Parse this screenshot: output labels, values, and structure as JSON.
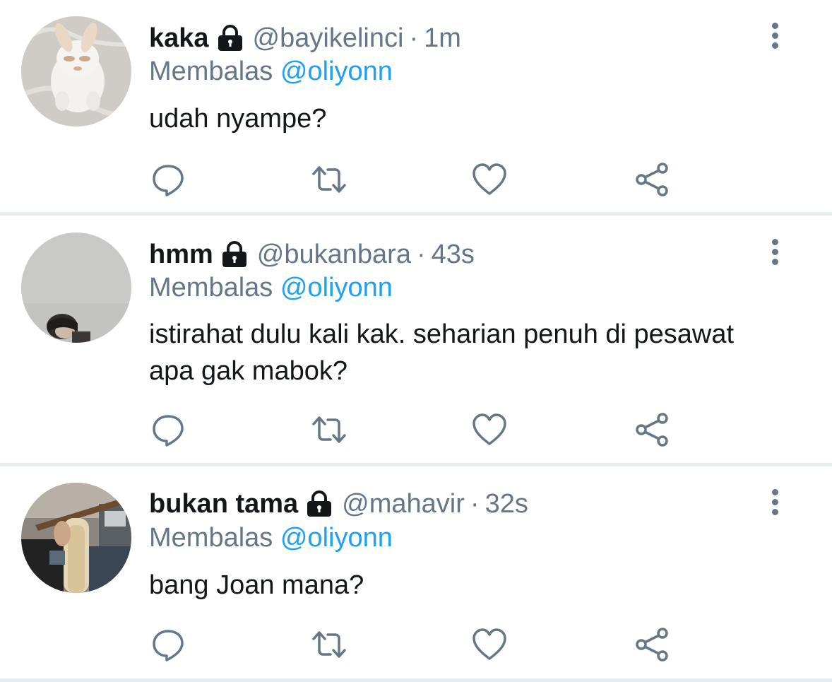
{
  "tweets": [
    {
      "name": "kaka",
      "handle": "@bayikelinci",
      "separator": "·",
      "time": "1m",
      "reply_prefix": "Membalas",
      "reply_to": "@oliyonn",
      "text": "udah nyampe?",
      "avatar": "rabbit-photo",
      "locked": true
    },
    {
      "name": "hmm",
      "handle": "@bukanbara",
      "separator": "·",
      "time": "43s",
      "reply_prefix": "Membalas",
      "reply_to": "@oliyonn",
      "text": "istirahat dulu kali kak. seharian penuh di pesawat apa gak mabok?",
      "avatar": "person-on-gray-photo",
      "locked": true
    },
    {
      "name": "bukan tama",
      "handle": "@mahavir",
      "separator": "·",
      "time": "32s",
      "reply_prefix": "Membalas",
      "reply_to": "@oliyonn",
      "text": "bang Joan mana?",
      "avatar": "guitar-player-photo",
      "locked": true
    }
  ],
  "icons": {
    "lock": "lock-icon",
    "more": "more-vertical-icon",
    "reply": "reply-icon",
    "retweet": "retweet-icon",
    "like": "heart-icon",
    "share": "share-icon"
  },
  "colors": {
    "name": "#14171a",
    "secondary": "#657786",
    "mention": "#1da1f2",
    "divider": "#e6ecf0",
    "background": "#ffffff"
  }
}
